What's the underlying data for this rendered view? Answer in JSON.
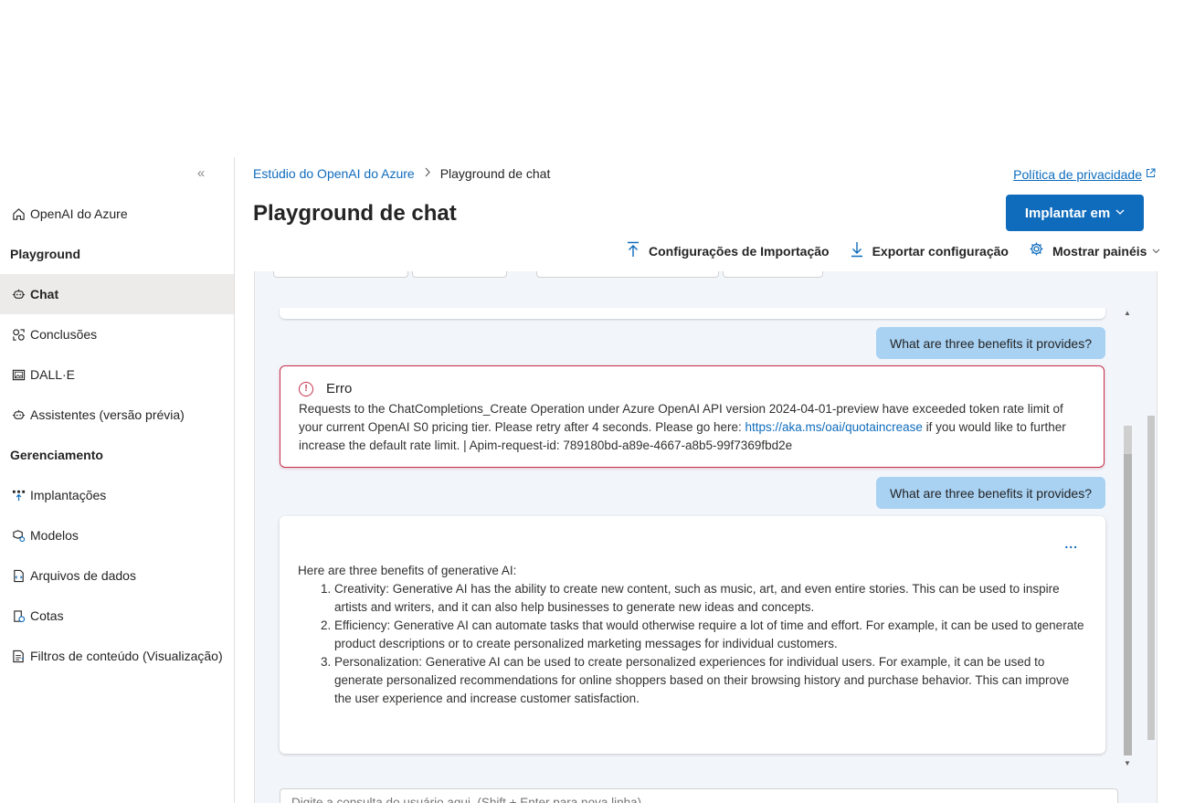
{
  "sidebar": {
    "collapse_icon": "«",
    "items": [
      {
        "label": "OpenAI do Azure",
        "icon": "home-icon"
      },
      {
        "label": "Chat",
        "icon": "chat-icon",
        "selected": true
      },
      {
        "label": "Conclusões",
        "icon": "completions-icon"
      },
      {
        "label": "DALL·E",
        "icon": "image-icon"
      },
      {
        "label": "Assistentes (versão prévia)",
        "icon": "assistant-icon"
      },
      {
        "label": "Implantações",
        "icon": "deployments-icon"
      },
      {
        "label": "Modelos",
        "icon": "models-icon"
      },
      {
        "label": "Arquivos de dados",
        "icon": "data-files-icon"
      },
      {
        "label": "Cotas",
        "icon": "quotas-icon"
      },
      {
        "label": "Filtros de conteúdo (Visualização)",
        "icon": "content-filter-icon"
      }
    ],
    "sections": {
      "playground": "Playground",
      "management": "Gerenciamento"
    }
  },
  "header": {
    "breadcrumb_root": "Estúdio do OpenAI do Azure",
    "breadcrumb_current": "Playground de chat",
    "privacy_link": "Política de privacidade",
    "title": "Playground de chat",
    "deploy_button": "Implantar em"
  },
  "toolbar": {
    "import": "Configurações de Importação",
    "export": "Exportar configuração",
    "show_panels": "Mostrar painéis"
  },
  "chat": {
    "user_message_1": "What are three benefits it provides?",
    "error_title": "Erro",
    "error_text_before_link": "Requests to the ChatCompletions_Create Operation under Azure OpenAI API version 2024-04-01-preview have exceeded token rate limit of your current OpenAI S0 pricing tier. Please retry after 4 seconds. Please go here: ",
    "error_link": "https://aka.ms/oai/quotaincrease",
    "error_text_after_link": " if you would like to further increase the default rate limit. | Apim-request-id: 789180bd-a89e-4667-a8b5-99f7369fbd2e",
    "user_message_2": "What are three benefits it provides?",
    "more_options": "...",
    "assistant_intro": "Here are three benefits of generative AI:",
    "assistant_benefits": [
      "Creativity: Generative AI has the ability to create new content, such as music, art, and even entire stories. This can be used to inspire artists and writers, and it can also help businesses to generate new ideas and concepts.",
      "Efficiency: Generative AI can automate tasks that would otherwise require a lot of time and effort. For example, it can be used to generate product descriptions or to create personalized marketing messages for individual customers.",
      "Personalization: Generative AI can be used to create personalized experiences for individual users. For example, it can be used to generate personalized recommendations for online shoppers based on their browsing history and purchase behavior. This can improve the user experience and increase customer satisfaction."
    ],
    "input_placeholder": "Digite a consulta do usuário aqui. (Shift + Enter para nova linha)"
  },
  "colors": {
    "accent": "#0f6cbd",
    "user_bubble": "#a8d1f2",
    "error_border": "#c4314b",
    "chat_background": "#f2f6fb",
    "selected_nav": "#edebe9"
  }
}
